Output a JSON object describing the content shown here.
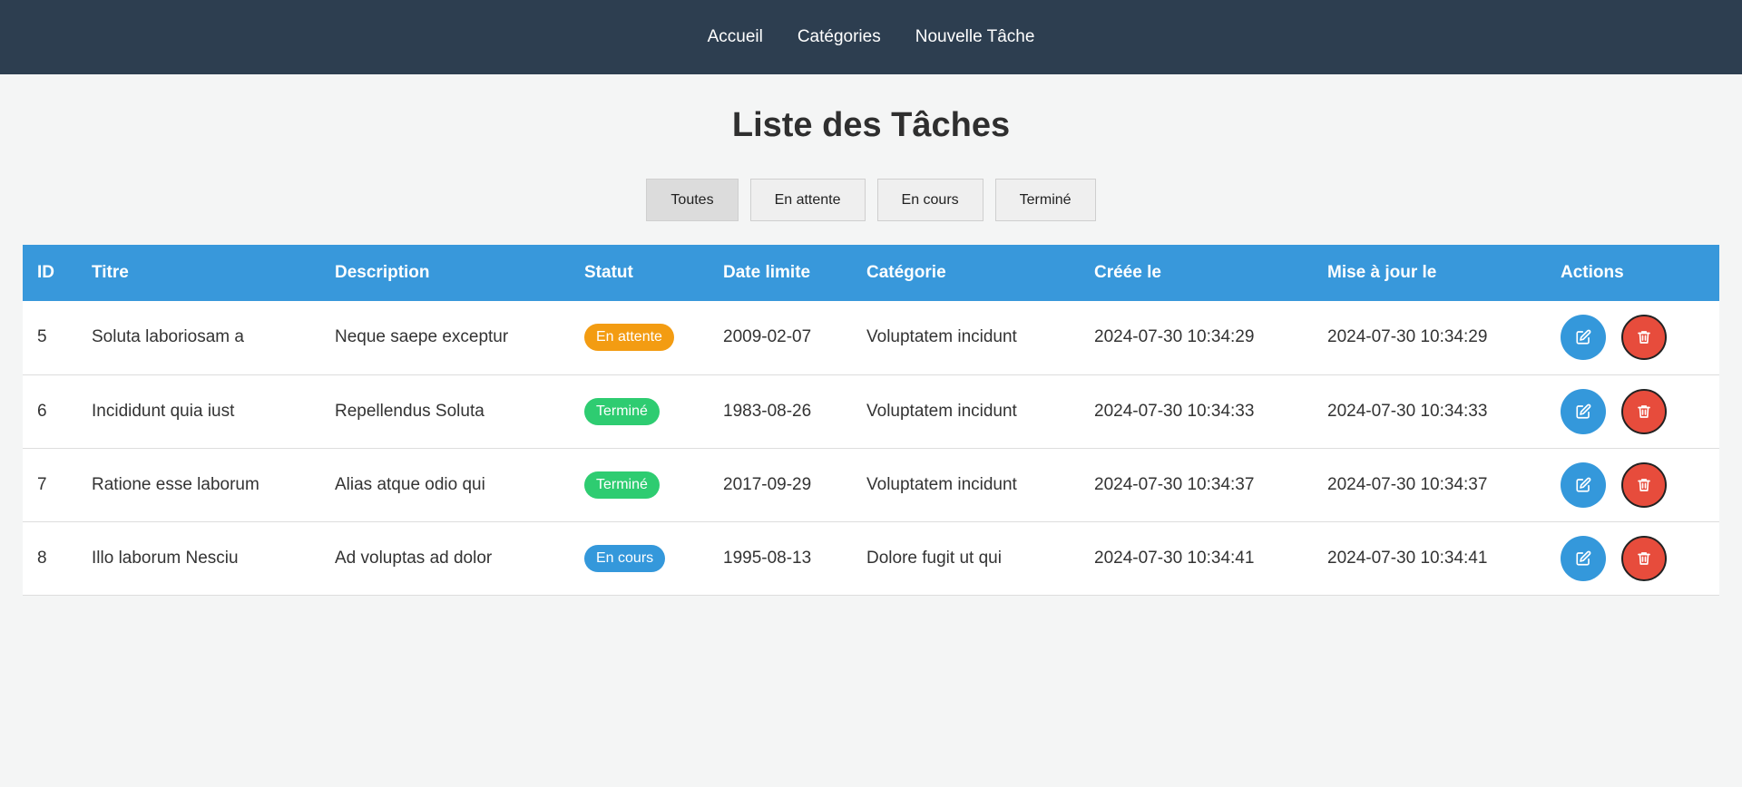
{
  "nav": {
    "items": [
      "Accueil",
      "Catégories",
      "Nouvelle Tâche"
    ]
  },
  "page": {
    "title": "Liste des Tâches"
  },
  "filters": [
    "Toutes",
    "En attente",
    "En cours",
    "Terminé"
  ],
  "filters_active": "Toutes",
  "table": {
    "columns": [
      "ID",
      "Titre",
      "Description",
      "Statut",
      "Date limite",
      "Catégorie",
      "Créée le",
      "Mise à jour le",
      "Actions"
    ],
    "rows": [
      {
        "id": "5",
        "title": "Soluta laboriosam a",
        "description": "Neque saepe exceptur",
        "status": "En attente",
        "status_type": "pending",
        "due": "2009-02-07",
        "category": "Voluptatem incidunt",
        "created": "2024-07-30 10:34:29",
        "updated": "2024-07-30 10:34:29"
      },
      {
        "id": "6",
        "title": "Incididunt quia iust",
        "description": "Repellendus Soluta",
        "status": "Terminé",
        "status_type": "done",
        "due": "1983-08-26",
        "category": "Voluptatem incidunt",
        "created": "2024-07-30 10:34:33",
        "updated": "2024-07-30 10:34:33"
      },
      {
        "id": "7",
        "title": "Ratione esse laborum",
        "description": "Alias atque odio qui",
        "status": "Terminé",
        "status_type": "done",
        "due": "2017-09-29",
        "category": "Voluptatem incidunt",
        "created": "2024-07-30 10:34:37",
        "updated": "2024-07-30 10:34:37"
      },
      {
        "id": "8",
        "title": "Illo laborum Nesciu",
        "description": "Ad voluptas ad dolor",
        "status": "En cours",
        "status_type": "progress",
        "due": "1995-08-13",
        "category": "Dolore fugit ut qui",
        "created": "2024-07-30 10:34:41",
        "updated": "2024-07-30 10:34:41"
      }
    ]
  },
  "icons": {
    "edit": "edit-icon",
    "delete": "trash-icon"
  },
  "colors": {
    "navbar": "#2d3e50",
    "header": "#3898db",
    "pending": "#f39c12",
    "done": "#2ecc71",
    "progress": "#3498db",
    "edit": "#3498db",
    "delete": "#e74c3c"
  }
}
